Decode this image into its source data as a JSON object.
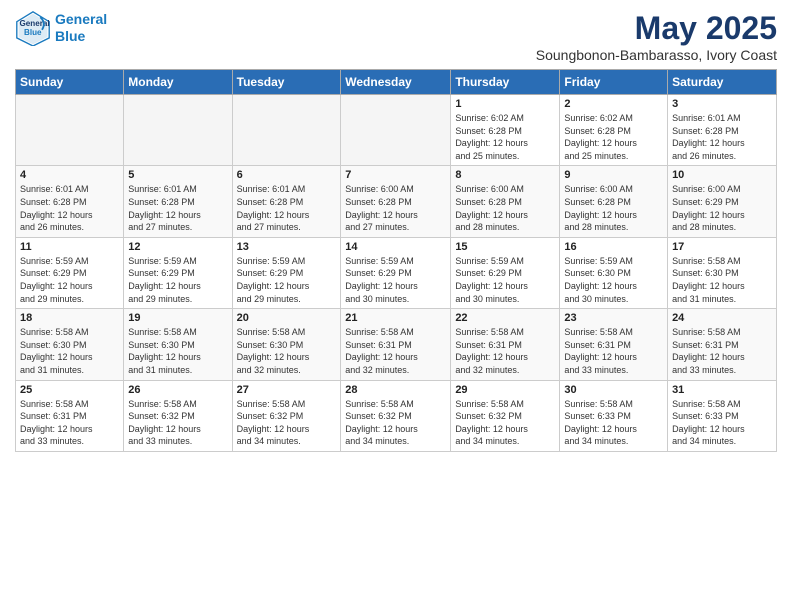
{
  "header": {
    "logo_line1": "General",
    "logo_line2": "Blue",
    "month": "May 2025",
    "location": "Soungbonon-Bambarasso, Ivory Coast"
  },
  "weekdays": [
    "Sunday",
    "Monday",
    "Tuesday",
    "Wednesday",
    "Thursday",
    "Friday",
    "Saturday"
  ],
  "weeks": [
    [
      {
        "day": "",
        "info": ""
      },
      {
        "day": "",
        "info": ""
      },
      {
        "day": "",
        "info": ""
      },
      {
        "day": "",
        "info": ""
      },
      {
        "day": "1",
        "info": "Sunrise: 6:02 AM\nSunset: 6:28 PM\nDaylight: 12 hours\nand 25 minutes."
      },
      {
        "day": "2",
        "info": "Sunrise: 6:02 AM\nSunset: 6:28 PM\nDaylight: 12 hours\nand 25 minutes."
      },
      {
        "day": "3",
        "info": "Sunrise: 6:01 AM\nSunset: 6:28 PM\nDaylight: 12 hours\nand 26 minutes."
      }
    ],
    [
      {
        "day": "4",
        "info": "Sunrise: 6:01 AM\nSunset: 6:28 PM\nDaylight: 12 hours\nand 26 minutes."
      },
      {
        "day": "5",
        "info": "Sunrise: 6:01 AM\nSunset: 6:28 PM\nDaylight: 12 hours\nand 27 minutes."
      },
      {
        "day": "6",
        "info": "Sunrise: 6:01 AM\nSunset: 6:28 PM\nDaylight: 12 hours\nand 27 minutes."
      },
      {
        "day": "7",
        "info": "Sunrise: 6:00 AM\nSunset: 6:28 PM\nDaylight: 12 hours\nand 27 minutes."
      },
      {
        "day": "8",
        "info": "Sunrise: 6:00 AM\nSunset: 6:28 PM\nDaylight: 12 hours\nand 28 minutes."
      },
      {
        "day": "9",
        "info": "Sunrise: 6:00 AM\nSunset: 6:28 PM\nDaylight: 12 hours\nand 28 minutes."
      },
      {
        "day": "10",
        "info": "Sunrise: 6:00 AM\nSunset: 6:29 PM\nDaylight: 12 hours\nand 28 minutes."
      }
    ],
    [
      {
        "day": "11",
        "info": "Sunrise: 5:59 AM\nSunset: 6:29 PM\nDaylight: 12 hours\nand 29 minutes."
      },
      {
        "day": "12",
        "info": "Sunrise: 5:59 AM\nSunset: 6:29 PM\nDaylight: 12 hours\nand 29 minutes."
      },
      {
        "day": "13",
        "info": "Sunrise: 5:59 AM\nSunset: 6:29 PM\nDaylight: 12 hours\nand 29 minutes."
      },
      {
        "day": "14",
        "info": "Sunrise: 5:59 AM\nSunset: 6:29 PM\nDaylight: 12 hours\nand 30 minutes."
      },
      {
        "day": "15",
        "info": "Sunrise: 5:59 AM\nSunset: 6:29 PM\nDaylight: 12 hours\nand 30 minutes."
      },
      {
        "day": "16",
        "info": "Sunrise: 5:59 AM\nSunset: 6:30 PM\nDaylight: 12 hours\nand 30 minutes."
      },
      {
        "day": "17",
        "info": "Sunrise: 5:58 AM\nSunset: 6:30 PM\nDaylight: 12 hours\nand 31 minutes."
      }
    ],
    [
      {
        "day": "18",
        "info": "Sunrise: 5:58 AM\nSunset: 6:30 PM\nDaylight: 12 hours\nand 31 minutes."
      },
      {
        "day": "19",
        "info": "Sunrise: 5:58 AM\nSunset: 6:30 PM\nDaylight: 12 hours\nand 31 minutes."
      },
      {
        "day": "20",
        "info": "Sunrise: 5:58 AM\nSunset: 6:30 PM\nDaylight: 12 hours\nand 32 minutes."
      },
      {
        "day": "21",
        "info": "Sunrise: 5:58 AM\nSunset: 6:31 PM\nDaylight: 12 hours\nand 32 minutes."
      },
      {
        "day": "22",
        "info": "Sunrise: 5:58 AM\nSunset: 6:31 PM\nDaylight: 12 hours\nand 32 minutes."
      },
      {
        "day": "23",
        "info": "Sunrise: 5:58 AM\nSunset: 6:31 PM\nDaylight: 12 hours\nand 33 minutes."
      },
      {
        "day": "24",
        "info": "Sunrise: 5:58 AM\nSunset: 6:31 PM\nDaylight: 12 hours\nand 33 minutes."
      }
    ],
    [
      {
        "day": "25",
        "info": "Sunrise: 5:58 AM\nSunset: 6:31 PM\nDaylight: 12 hours\nand 33 minutes."
      },
      {
        "day": "26",
        "info": "Sunrise: 5:58 AM\nSunset: 6:32 PM\nDaylight: 12 hours\nand 33 minutes."
      },
      {
        "day": "27",
        "info": "Sunrise: 5:58 AM\nSunset: 6:32 PM\nDaylight: 12 hours\nand 34 minutes."
      },
      {
        "day": "28",
        "info": "Sunrise: 5:58 AM\nSunset: 6:32 PM\nDaylight: 12 hours\nand 34 minutes."
      },
      {
        "day": "29",
        "info": "Sunrise: 5:58 AM\nSunset: 6:32 PM\nDaylight: 12 hours\nand 34 minutes."
      },
      {
        "day": "30",
        "info": "Sunrise: 5:58 AM\nSunset: 6:33 PM\nDaylight: 12 hours\nand 34 minutes."
      },
      {
        "day": "31",
        "info": "Sunrise: 5:58 AM\nSunset: 6:33 PM\nDaylight: 12 hours\nand 34 minutes."
      }
    ]
  ]
}
